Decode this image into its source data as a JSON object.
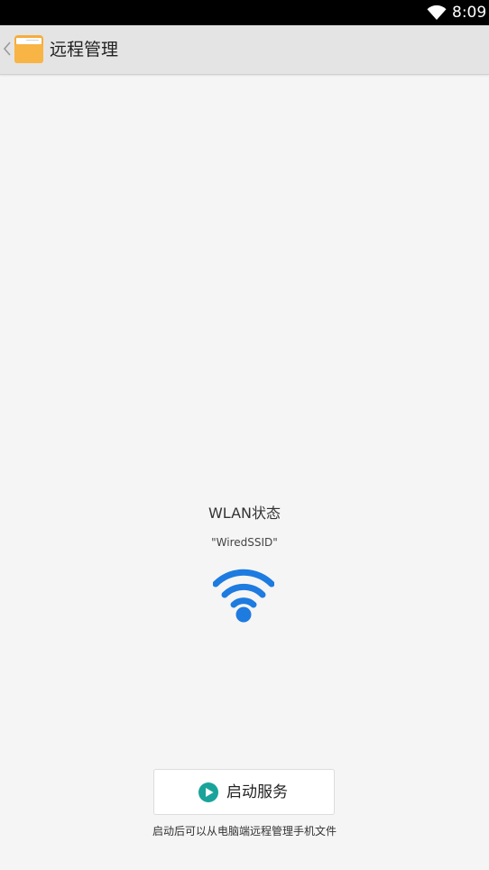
{
  "status_bar": {
    "time": "8:09",
    "wifi_icon": "wifi-icon"
  },
  "app_bar": {
    "back_icon": "chevron-left-icon",
    "app_icon": "folder-icon",
    "title": "远程管理"
  },
  "wlan": {
    "title": "WLAN状态",
    "ssid": "\"WiredSSID\"",
    "icon": "wifi-icon",
    "icon_color": "#1e7be0"
  },
  "start_button": {
    "icon": "play-circle-icon",
    "icon_color": "#1aa39a",
    "label": "启动服务"
  },
  "hint": "启动后可以从电脑端远程管理手机文件",
  "colors": {
    "background": "#f5f5f5",
    "app_bar": "#e4e4e4",
    "folder": "#f6ad3a"
  }
}
